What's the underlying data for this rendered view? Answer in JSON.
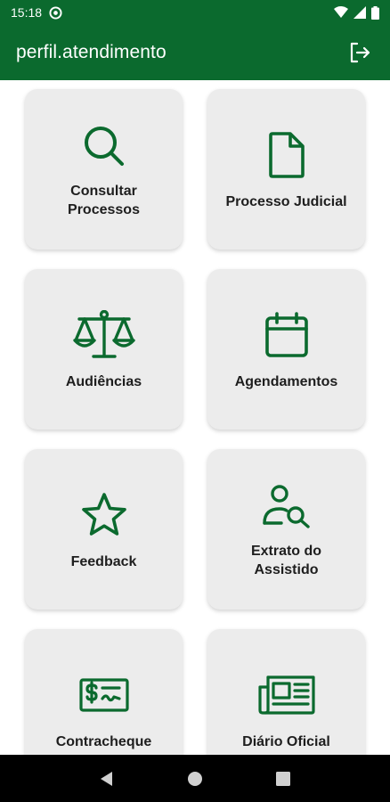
{
  "status_bar": {
    "time": "15:18"
  },
  "app_bar": {
    "title": "perfil.atendimento"
  },
  "menu": {
    "items": [
      {
        "label": "Consultar\nProcessos",
        "icon": "search-icon"
      },
      {
        "label": "Processo Judicial",
        "icon": "document-icon"
      },
      {
        "label": "Audiências",
        "icon": "scales-icon"
      },
      {
        "label": "Agendamentos",
        "icon": "calendar-icon"
      },
      {
        "label": "Feedback",
        "icon": "star-icon"
      },
      {
        "label": "Extrato do\nAssistido",
        "icon": "user-search-icon"
      },
      {
        "label": "Contracheque",
        "icon": "paycheck-icon"
      },
      {
        "label": "Diário Oficial",
        "icon": "newspaper-icon"
      }
    ]
  },
  "colors": {
    "primary": "#0b6a2e",
    "card_background": "#ececec",
    "label_text": "#1e1e1e"
  }
}
